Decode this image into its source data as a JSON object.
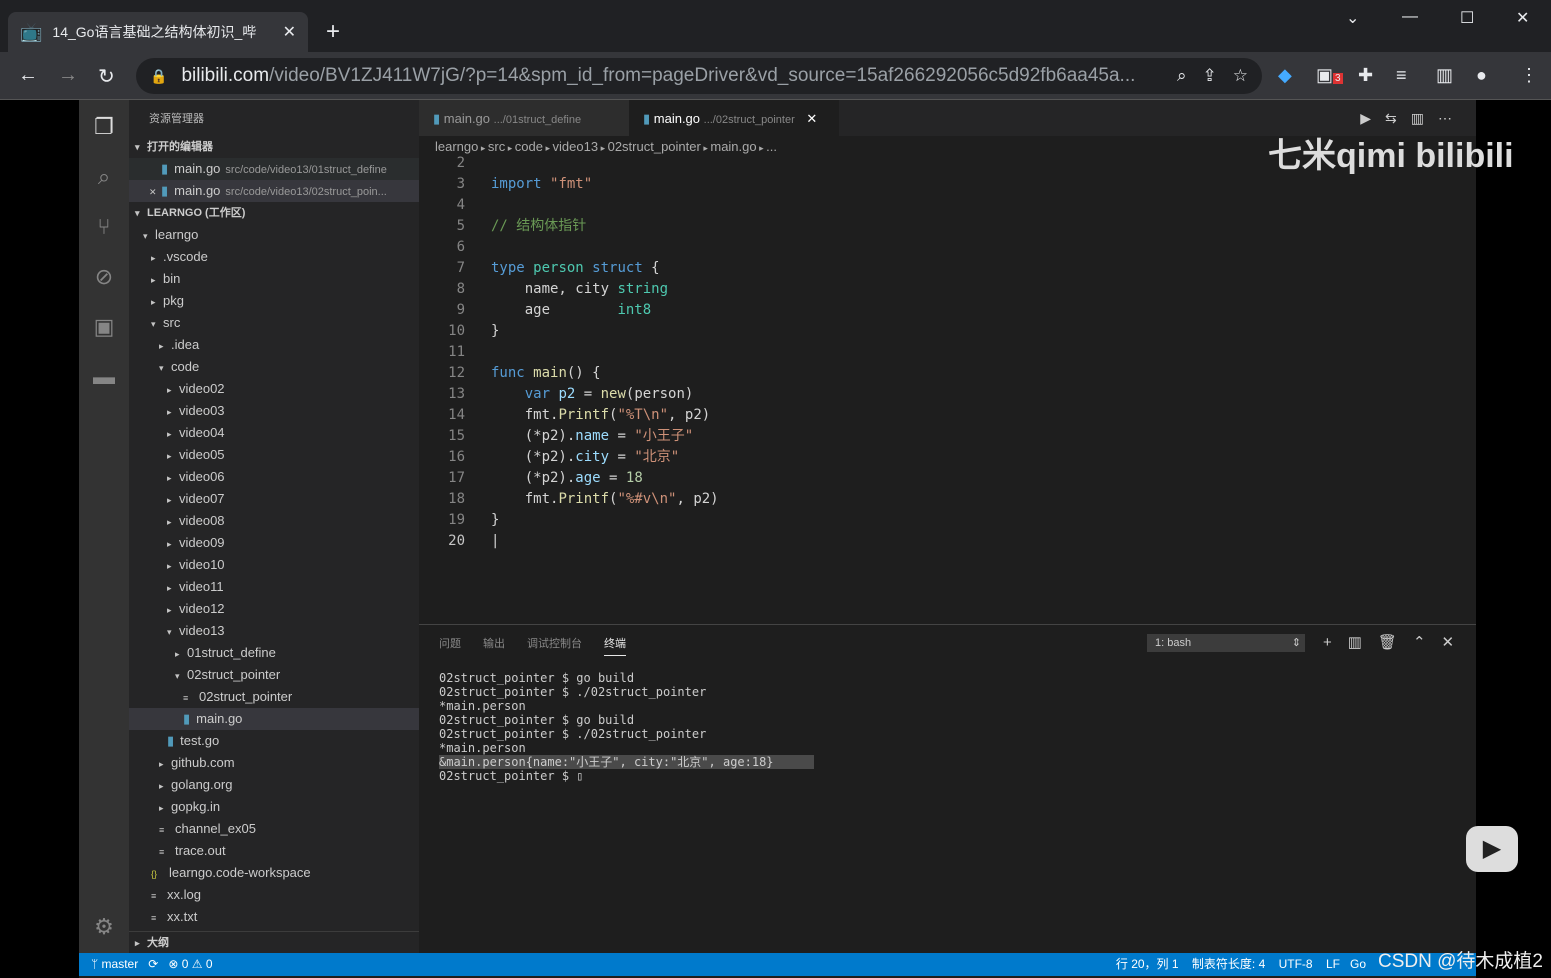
{
  "browser": {
    "tab_title": "14_Go语言基础之结构体初识_哔",
    "url_host": "bilibili.com",
    "url_path": "/video/BV1ZJ411W7jG/?p=14&spm_id_from=pageDriver&vd_source=15af266292056c5d92fb6aa45a...",
    "ext_badge": "3"
  },
  "sidebar": {
    "title": "资源管理器",
    "open_editors": "打开的编辑器",
    "open": [
      {
        "name": "main.go",
        "path": "src/code/video13/01struct_define"
      },
      {
        "name": "main.go",
        "path": "src/code/video13/02struct_poin..."
      }
    ],
    "workspace": "LEARNGO (工作区)",
    "tree": [
      {
        "label": "learngo",
        "d": 1,
        "t": "▾"
      },
      {
        "label": ".vscode",
        "d": 2,
        "t": "▸"
      },
      {
        "label": "bin",
        "d": 2,
        "t": "▸"
      },
      {
        "label": "pkg",
        "d": 2,
        "t": "▸"
      },
      {
        "label": "src",
        "d": 2,
        "t": "▾"
      },
      {
        "label": ".idea",
        "d": 3,
        "t": "▸"
      },
      {
        "label": "code",
        "d": 3,
        "t": "▾"
      },
      {
        "label": "video02",
        "d": 4,
        "t": "▸"
      },
      {
        "label": "video03",
        "d": 4,
        "t": "▸"
      },
      {
        "label": "video04",
        "d": 4,
        "t": "▸"
      },
      {
        "label": "video05",
        "d": 4,
        "t": "▸"
      },
      {
        "label": "video06",
        "d": 4,
        "t": "▸"
      },
      {
        "label": "video07",
        "d": 4,
        "t": "▸"
      },
      {
        "label": "video08",
        "d": 4,
        "t": "▸"
      },
      {
        "label": "video09",
        "d": 4,
        "t": "▸"
      },
      {
        "label": "video10",
        "d": 4,
        "t": "▸"
      },
      {
        "label": "video11",
        "d": 4,
        "t": "▸"
      },
      {
        "label": "video12",
        "d": 4,
        "t": "▸"
      },
      {
        "label": "video13",
        "d": 4,
        "t": "▾"
      },
      {
        "label": "01struct_define",
        "d": 5,
        "t": "▸"
      },
      {
        "label": "02struct_pointer",
        "d": 5,
        "t": "▾"
      },
      {
        "label": "02struct_pointer",
        "d": 6,
        "t": "≡"
      },
      {
        "label": "main.go",
        "d": 6,
        "t": "go",
        "sel": true
      },
      {
        "label": "test.go",
        "d": 4,
        "t": "go"
      },
      {
        "label": "github.com",
        "d": 3,
        "t": "▸"
      },
      {
        "label": "golang.org",
        "d": 3,
        "t": "▸"
      },
      {
        "label": "gopkg.in",
        "d": 3,
        "t": "▸"
      },
      {
        "label": "channel_ex05",
        "d": 3,
        "t": "≡"
      },
      {
        "label": "trace.out",
        "d": 3,
        "t": "≡"
      },
      {
        "label": "learngo.code-workspace",
        "d": 2,
        "t": "{}"
      },
      {
        "label": "xx.log",
        "d": 2,
        "t": "≡"
      },
      {
        "label": "xx.txt",
        "d": 2,
        "t": "≡"
      }
    ],
    "outline": "大纲"
  },
  "editor": {
    "tabs": [
      {
        "name": "main.go",
        "path": ".../01struct_define"
      },
      {
        "name": "main.go",
        "path": ".../02struct_pointer"
      }
    ],
    "breadcrumb": [
      "learngo",
      "src",
      "code",
      "video13",
      "02struct_pointer",
      "main.go",
      "..."
    ],
    "lines": [
      {
        "n": "2",
        "h": ""
      },
      {
        "n": "3",
        "h": "<span class='k'>import</span> <span class='s'>\"fmt\"</span>"
      },
      {
        "n": "4",
        "h": ""
      },
      {
        "n": "5",
        "h": "<span class='c'>// 结构体指针</span>"
      },
      {
        "n": "6",
        "h": ""
      },
      {
        "n": "7",
        "h": "<span class='k'>type</span> <span class='ty'>person</span> <span class='k'>struct</span> {"
      },
      {
        "n": "8",
        "h": "    name, city <span class='ty'>string</span>"
      },
      {
        "n": "9",
        "h": "    age        <span class='ty'>int8</span>"
      },
      {
        "n": "10",
        "h": "}"
      },
      {
        "n": "11",
        "h": ""
      },
      {
        "n": "12",
        "h": "<span class='k'>func</span> <span class='f'>main</span>() {"
      },
      {
        "n": "13",
        "h": "    <span class='k'>var</span> <span class='v'>p2</span> = <span class='f'>new</span>(person)"
      },
      {
        "n": "14",
        "h": "    fmt.<span class='f'>Printf</span>(<span class='s'>\"%T\\n\"</span>, p2)"
      },
      {
        "n": "15",
        "h": "    (*p2).<span class='v'>name</span> = <span class='s'>\"小王子\"</span>"
      },
      {
        "n": "16",
        "h": "    (*p2).<span class='v'>city</span> = <span class='s'>\"北京\"</span>"
      },
      {
        "n": "17",
        "h": "    (*p2).<span class='v'>age</span> = <span class='nm'>18</span>"
      },
      {
        "n": "18",
        "h": "    fmt.<span class='f'>Printf</span>(<span class='s'>\"%#v\\n\"</span>, p2)"
      },
      {
        "n": "19",
        "h": "}"
      },
      {
        "n": "20",
        "h": "|"
      }
    ]
  },
  "panel": {
    "tabs": [
      "问题",
      "输出",
      "调试控制台",
      "终端"
    ],
    "terminal_select": "1: bash",
    "terminal": [
      "02struct_pointer $ go build",
      "02struct_pointer $ ./02struct_pointer",
      "*main.person",
      "02struct_pointer $ go build",
      "02struct_pointer $ ./02struct_pointer",
      "*main.person",
      "&main.person{name:\"小王子\", city:\"北京\", age:18}",
      "02struct_pointer $ ▯"
    ]
  },
  "status": {
    "branch": "master",
    "errors": "0",
    "warnings": "0",
    "position": "行 20，列 1",
    "tab_size": "制表符长度: 4",
    "encoding": "UTF-8",
    "eol": "LF",
    "lang": "Go"
  },
  "watermark": {
    "brand": "七米qimi bilibili",
    "csdn": "CSDN @待木成植2"
  }
}
